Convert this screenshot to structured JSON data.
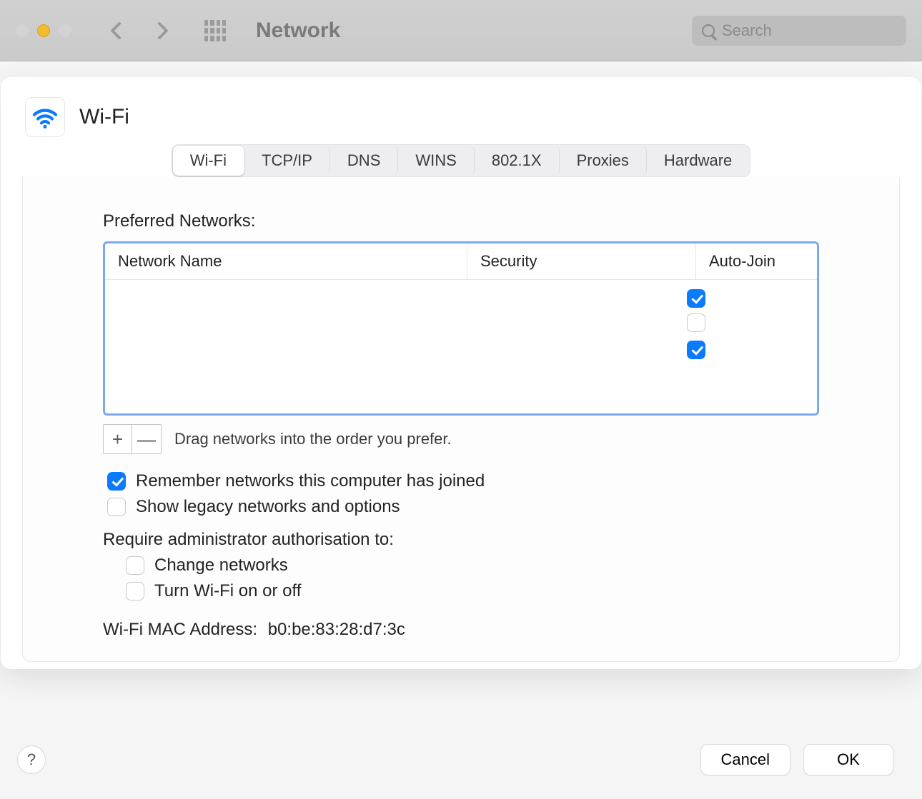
{
  "window": {
    "title": "Network",
    "search_placeholder": "Search"
  },
  "header": {
    "title": "Wi-Fi"
  },
  "tabs": [
    {
      "label": "Wi-Fi",
      "active": true
    },
    {
      "label": "TCP/IP",
      "active": false
    },
    {
      "label": "DNS",
      "active": false
    },
    {
      "label": "WINS",
      "active": false
    },
    {
      "label": "802.1X",
      "active": false
    },
    {
      "label": "Proxies",
      "active": false
    },
    {
      "label": "Hardware",
      "active": false
    }
  ],
  "preferred": {
    "label": "Preferred Networks:",
    "columns": {
      "name": "Network Name",
      "security": "Security",
      "autojoin": "Auto-Join"
    },
    "rows": [
      {
        "name": "(redacted)",
        "security": "(redacted)",
        "auto_join": true
      },
      {
        "name": "(redacted)",
        "security": "(redacted)",
        "auto_join": false
      },
      {
        "name": "(redacted)",
        "security": "(redacted)",
        "auto_join": true
      }
    ],
    "drag_hint": "Drag networks into the order you prefer."
  },
  "options": {
    "remember": {
      "label": "Remember networks this computer has joined",
      "checked": true
    },
    "show_legacy": {
      "label": "Show legacy networks and options",
      "checked": false
    },
    "require_admin_label": "Require administrator authorisation to:",
    "change_networks": {
      "label": "Change networks",
      "checked": false
    },
    "toggle_wifi": {
      "label": "Turn Wi-Fi on or off",
      "checked": false
    }
  },
  "mac": {
    "label": "Wi-Fi MAC Address:",
    "value": "b0:be:83:28:d7:3c"
  },
  "footer": {
    "help": "?",
    "cancel": "Cancel",
    "ok": "OK"
  },
  "buttons": {
    "add": "+",
    "remove": "—"
  }
}
